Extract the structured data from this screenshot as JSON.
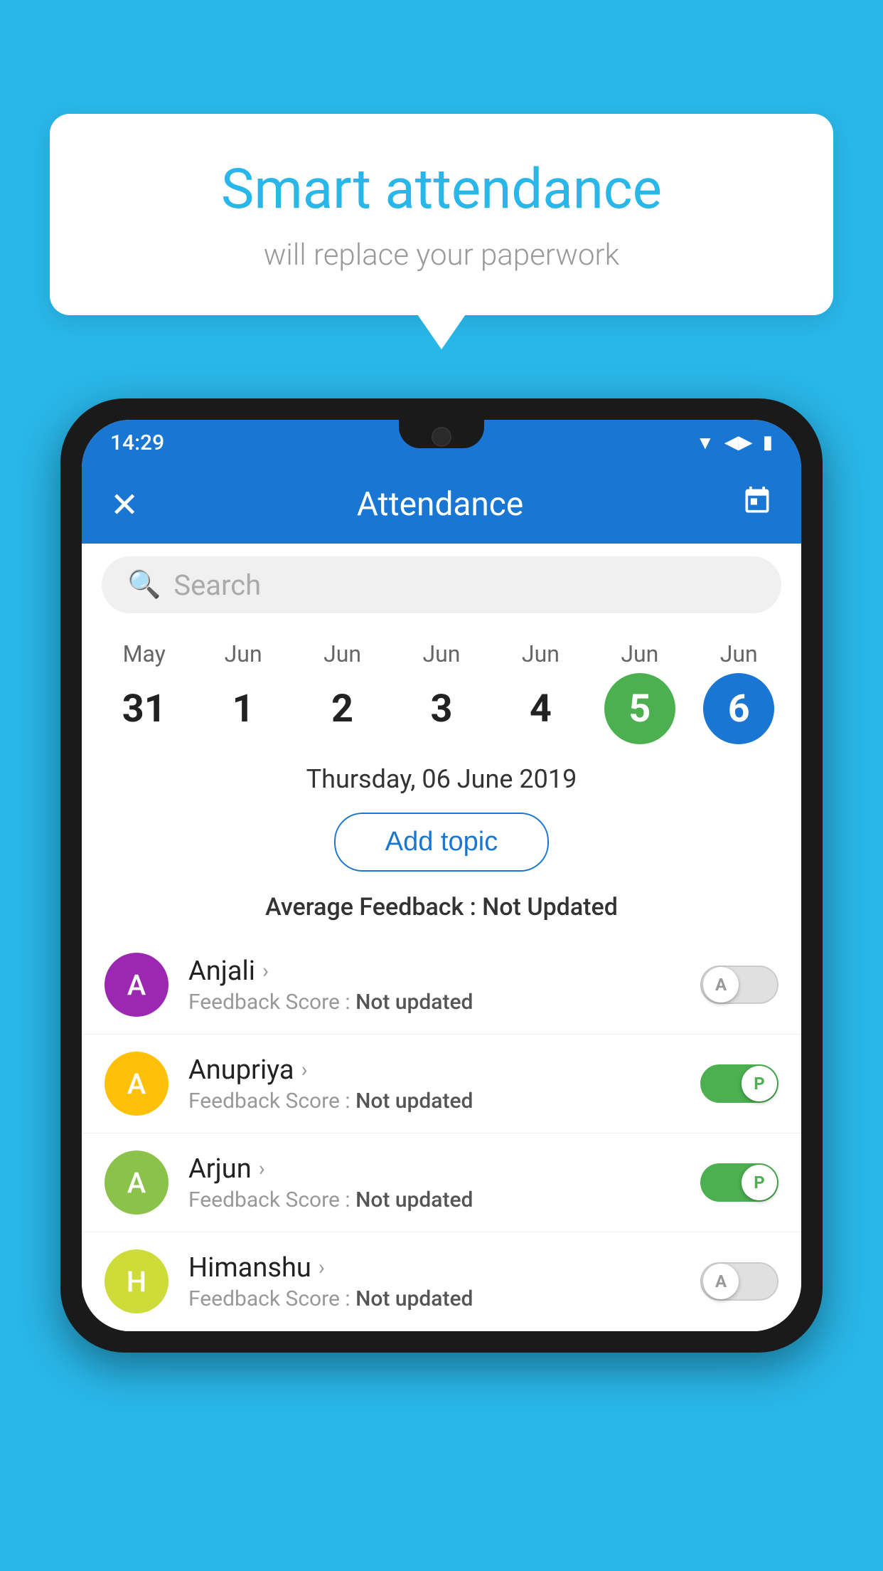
{
  "background_color": "#29b6e8",
  "speech_bubble": {
    "title": "Smart attendance",
    "subtitle": "will replace your paperwork"
  },
  "status_bar": {
    "time": "14:29",
    "wifi": "▼",
    "signal": "▲",
    "battery": "▮"
  },
  "app_bar": {
    "title": "Attendance",
    "close_label": "✕",
    "calendar_icon": "📅"
  },
  "search": {
    "placeholder": "Search"
  },
  "calendar": {
    "days": [
      {
        "month": "May",
        "date": "31",
        "state": "normal"
      },
      {
        "month": "Jun",
        "date": "1",
        "state": "normal"
      },
      {
        "month": "Jun",
        "date": "2",
        "state": "normal"
      },
      {
        "month": "Jun",
        "date": "3",
        "state": "normal"
      },
      {
        "month": "Jun",
        "date": "4",
        "state": "normal"
      },
      {
        "month": "Jun",
        "date": "5",
        "state": "today"
      },
      {
        "month": "Jun",
        "date": "6",
        "state": "selected"
      }
    ],
    "selected_date_label": "Thursday, 06 June 2019"
  },
  "add_topic_button": "Add topic",
  "average_feedback_label": "Average Feedback :",
  "average_feedback_value": "Not Updated",
  "students": [
    {
      "name": "Anjali",
      "avatar_letter": "A",
      "avatar_color": "purple",
      "feedback_label": "Feedback Score :",
      "feedback_value": "Not updated",
      "toggle_state": "off",
      "toggle_label": "A"
    },
    {
      "name": "Anupriya",
      "avatar_letter": "A",
      "avatar_color": "yellow",
      "feedback_label": "Feedback Score :",
      "feedback_value": "Not updated",
      "toggle_state": "on",
      "toggle_label": "P"
    },
    {
      "name": "Arjun",
      "avatar_letter": "A",
      "avatar_color": "light-green",
      "feedback_label": "Feedback Score :",
      "feedback_value": "Not updated",
      "toggle_state": "on",
      "toggle_label": "P"
    },
    {
      "name": "Himanshu",
      "avatar_letter": "H",
      "avatar_color": "olive",
      "feedback_label": "Feedback Score :",
      "feedback_value": "Not updated",
      "toggle_state": "off",
      "toggle_label": "A"
    }
  ]
}
